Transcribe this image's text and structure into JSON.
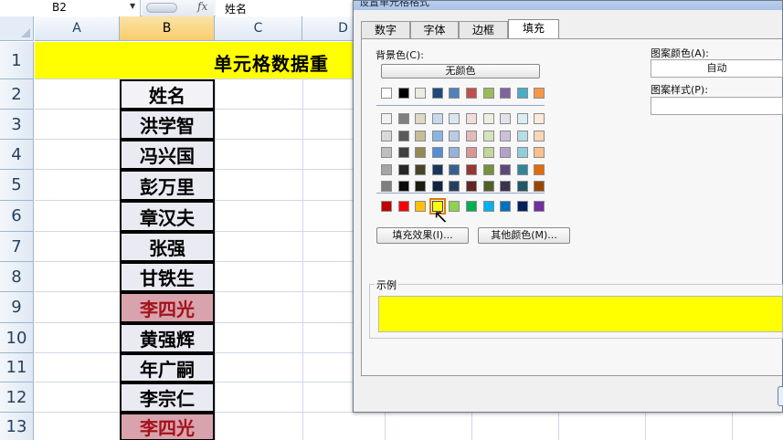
{
  "formula_bar": {
    "name_box": "B2",
    "fx_label": "fx",
    "content": "姓名"
  },
  "sheet": {
    "columns": [
      "A",
      "B",
      "C",
      "D"
    ],
    "rows": [
      "1",
      "2",
      "3",
      "4",
      "5",
      "6",
      "7",
      "8",
      "9",
      "10",
      "11",
      "12",
      "13"
    ],
    "title": "单元格数据重",
    "names": [
      {
        "text": "姓名",
        "dup": false
      },
      {
        "text": "洪学智",
        "dup": false
      },
      {
        "text": "冯兴国",
        "dup": false
      },
      {
        "text": "彭万里",
        "dup": false
      },
      {
        "text": "章汉夫",
        "dup": false
      },
      {
        "text": "张强",
        "dup": false
      },
      {
        "text": "甘铁生",
        "dup": false
      },
      {
        "text": "李四光",
        "dup": true
      },
      {
        "text": "黄强辉",
        "dup": false
      },
      {
        "text": "年广嗣",
        "dup": false
      },
      {
        "text": "李宗仁",
        "dup": false
      },
      {
        "text": "李四光",
        "dup": true
      }
    ]
  },
  "dialog": {
    "title": "设置单元格格式",
    "tabs": [
      "数字",
      "字体",
      "边框",
      "填充"
    ],
    "active_tab": "填充",
    "background_color_label": "背景色(C):",
    "no_color_button": "无颜色",
    "pattern_color_label": "图案颜色(A):",
    "pattern_color_value": "自动",
    "pattern_style_label": "图案样式(P):",
    "fill_effects_button": "填充效果(I)...",
    "more_colors_button": "其他颜色(M)...",
    "sample_label": "示例",
    "sample_color": "#FFFF00",
    "palette": {
      "top_row": [
        "#FFFFFF",
        "#000000",
        "#EEECE1",
        "#1F497D",
        "#4F81BD",
        "#C0504D",
        "#9BBB59",
        "#8064A2",
        "#4BACC6",
        "#F79646"
      ],
      "tint_rows": [
        [
          "#F2F2F2",
          "#7F7F7F",
          "#DDD9C3",
          "#C6D9F0",
          "#DBE5F1",
          "#F2DCDB",
          "#EBF1DD",
          "#E5E0EC",
          "#DBEEF3",
          "#FDEADA"
        ],
        [
          "#D8D8D8",
          "#595959",
          "#C4BD97",
          "#8DB3E2",
          "#B8CCE4",
          "#E5B9B7",
          "#D7E3BC",
          "#CCC1D9",
          "#B7DDE8",
          "#FBD5B5"
        ],
        [
          "#BFBFBF",
          "#3F3F3F",
          "#938953",
          "#548DD4",
          "#95B3D7",
          "#D99694",
          "#C3D69B",
          "#B2A2C7",
          "#92CDDC",
          "#FAC08F"
        ],
        [
          "#A5A5A5",
          "#262626",
          "#494429",
          "#17365D",
          "#366092",
          "#953734",
          "#76923C",
          "#5F497A",
          "#31859B",
          "#E36C09"
        ],
        [
          "#7F7F7F",
          "#0C0C0C",
          "#1D1B10",
          "#0F243E",
          "#244061",
          "#632423",
          "#4F6128",
          "#3F3151",
          "#205867",
          "#974806"
        ]
      ],
      "standard_row": [
        "#C00000",
        "#FF0000",
        "#FFC000",
        "#FFFF00",
        "#92D050",
        "#00B050",
        "#00B0F0",
        "#0070C0",
        "#002060",
        "#7030A0"
      ],
      "selected": "#FFFF00"
    }
  }
}
